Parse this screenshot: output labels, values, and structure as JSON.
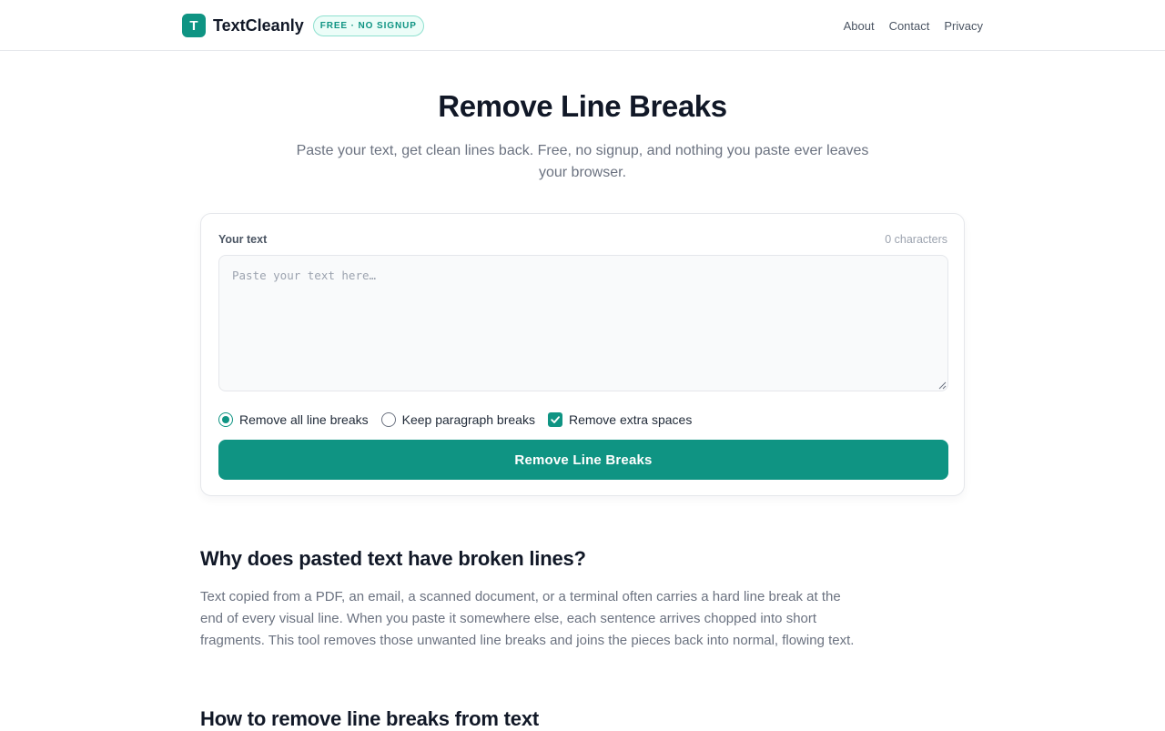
{
  "header": {
    "logo_letter": "T",
    "brand_name": "TextCleanly",
    "badge": "FREE · NO SIGNUP",
    "nav": [
      {
        "label": "About"
      },
      {
        "label": "Contact"
      },
      {
        "label": "Privacy"
      }
    ]
  },
  "hero": {
    "title": "Remove Line Breaks",
    "subtitle": "Paste your text, get clean lines back. Free, no signup, and nothing you paste ever leaves your browser."
  },
  "tool": {
    "label": "Your text",
    "char_count": "0 characters",
    "input_value": "",
    "placeholder": "Paste your text here…",
    "options": [
      {
        "label": "Remove all line breaks",
        "type": "radio",
        "checked": true
      },
      {
        "label": "Keep paragraph breaks",
        "type": "radio",
        "checked": false
      },
      {
        "label": "Remove extra spaces",
        "type": "checkbox",
        "checked": true
      }
    ],
    "submit_label": "Remove Line Breaks"
  },
  "content": {
    "sections": [
      {
        "heading": "Why does pasted text have broken lines?",
        "body": "Text copied from a PDF, an email, a scanned document, or a terminal often carries a hard line break at the end of every visual line. When you paste it somewhere else, each sentence arrives chopped into short fragments. This tool removes those unwanted line breaks and joins the pieces back into normal, flowing text."
      },
      {
        "heading": "How to remove line breaks from text"
      }
    ]
  },
  "colors": {
    "accent": "#0f9483",
    "text": "#111827",
    "muted": "#6b7280",
    "border": "#e5e7eb"
  }
}
